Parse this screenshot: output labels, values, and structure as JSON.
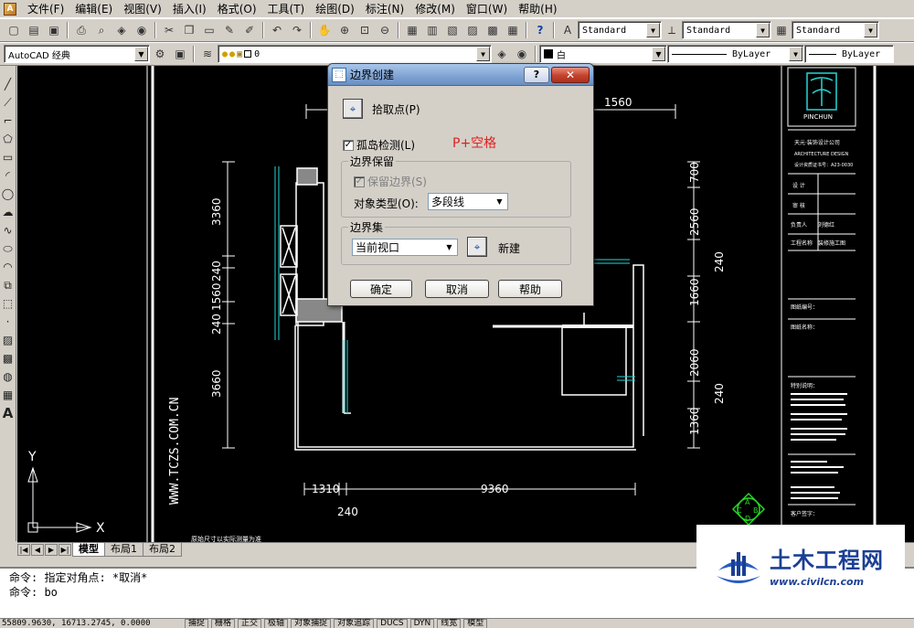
{
  "menubar": {
    "items": [
      "文件(F)",
      "编辑(E)",
      "视图(V)",
      "插入(I)",
      "格式(O)",
      "工具(T)",
      "绘图(D)",
      "标注(N)",
      "修改(M)",
      "窗口(W)",
      "帮助(H)"
    ]
  },
  "toolbar": {
    "text_style": "Standard",
    "dim_style": "Standard",
    "table_style": "Standard",
    "workspace": "AutoCAD 经典",
    "layer": "0",
    "color": "白",
    "linetype": "ByLayer",
    "lineweight": "ByLayer"
  },
  "drawing": {
    "dimensions_top": [
      "1560"
    ],
    "dimensions_left": [
      "3360",
      "240",
      "1560",
      "240",
      "3660"
    ],
    "dimensions_right": [
      "700",
      "2560",
      "240",
      "1660",
      "2060",
      "240",
      "1360"
    ],
    "dimensions_bottom": [
      "1310",
      "9360",
      "240"
    ],
    "watermark_vertical": "WWW.TCZS.COM.CN",
    "caption": "原始尺寸以实际测量为准",
    "ucs_x": "X",
    "ucs_y": "Y",
    "compass": [
      "A",
      "B",
      "C",
      "D"
    ]
  },
  "titleblock": {
    "brand": "PINCHUN",
    "company": "天元·装饰设计公司",
    "line1": "ARCHITECTURE DESIGN",
    "line2": "设计资质证书号：A23-0030",
    "designer_label": "设 计",
    "checker_label": "审 核",
    "owner_label": "负责人",
    "owner_value": "刘德红",
    "project_label": "工程名称",
    "project_value": "装修施工图",
    "drawing_no_label": "图纸编号：",
    "date_label": "图纸名称：",
    "notes_title": "特别说明：",
    "footer_label": "客户签字："
  },
  "tabs": {
    "model": "模型",
    "layout1": "布局1",
    "layout2": "布局2"
  },
  "dialog": {
    "title": "边界创建",
    "help_button": "?",
    "close_button": "✕",
    "pick_points_label": "拾取点(P)",
    "island_detection_label": "孤岛检测(L)",
    "annotation": "P+空格",
    "retention_group": "边界保留",
    "retain_boundaries_label": "保留边界(S)",
    "object_type_label": "对象类型(O):",
    "object_type_value": "多段线",
    "boundary_set_group": "边界集",
    "boundary_set_value": "当前视口",
    "new_label": "新建",
    "ok": "确定",
    "cancel": "取消",
    "help": "帮助"
  },
  "command": {
    "line1": "命令: 指定对角点: *取消*",
    "line2": "命令: bo"
  },
  "statusbar": {
    "coords": "55809.9630, 16713.2745, 0.0000",
    "buttons": [
      "捕捉",
      "栅格",
      "正交",
      "极轴",
      "对象捕捉",
      "对象追踪",
      "DUCS",
      "DYN",
      "线宽",
      "模型"
    ]
  },
  "watermark": {
    "name": "土木工程网",
    "url": "www.civilcn.com"
  }
}
